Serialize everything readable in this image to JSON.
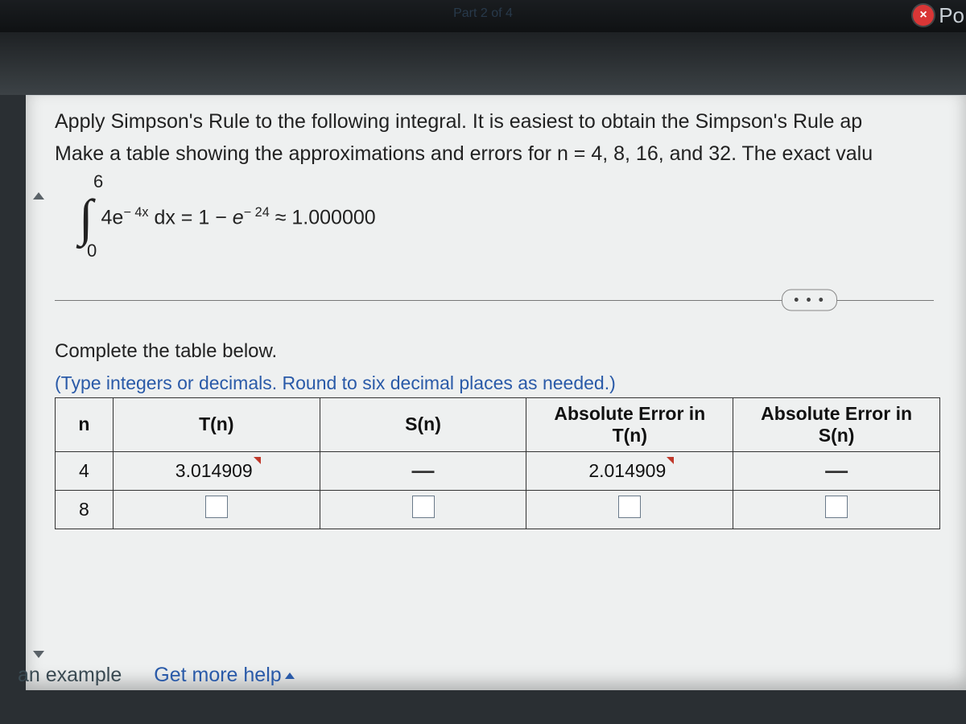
{
  "topbar": {
    "part_indicator": "Part 2 of 4",
    "close_icon": "×",
    "corner_fragment": "Po"
  },
  "prompt": {
    "line1": "Apply Simpson's Rule to the following integral. It is easiest to obtain the Simpson's Rule ap",
    "line2": "Make a table showing the approximations and errors for n = 4, 8, 16, and 32. The exact valu"
  },
  "integral": {
    "upper": "6",
    "lower": "0",
    "integrand_base": "4e",
    "integrand_exp": "− 4x",
    "dx": " dx = 1 − ",
    "rhs_base": "e",
    "rhs_exp": "− 24",
    "approx": " ≈ 1.000000"
  },
  "ellipsis": "• • •",
  "section": "Complete the table below.",
  "hint": "(Type integers or decimals. Round to six decimal places as needed.)",
  "table": {
    "headers": {
      "n": "n",
      "tn": "T(n)",
      "sn": "S(n)",
      "err_tn_l1": "Absolute Error in",
      "err_tn_l2": "T(n)",
      "err_sn_l1": "Absolute Error in",
      "err_sn_l2": "S(n)"
    },
    "rows": [
      {
        "n": "4",
        "tn": "3.014909",
        "sn": "—",
        "err_tn": "2.014909",
        "err_sn": "—"
      },
      {
        "n": "8",
        "tn": "",
        "sn": "",
        "err_tn": "",
        "err_sn": ""
      }
    ]
  },
  "links": {
    "example": "an example",
    "help": "Get more help"
  }
}
